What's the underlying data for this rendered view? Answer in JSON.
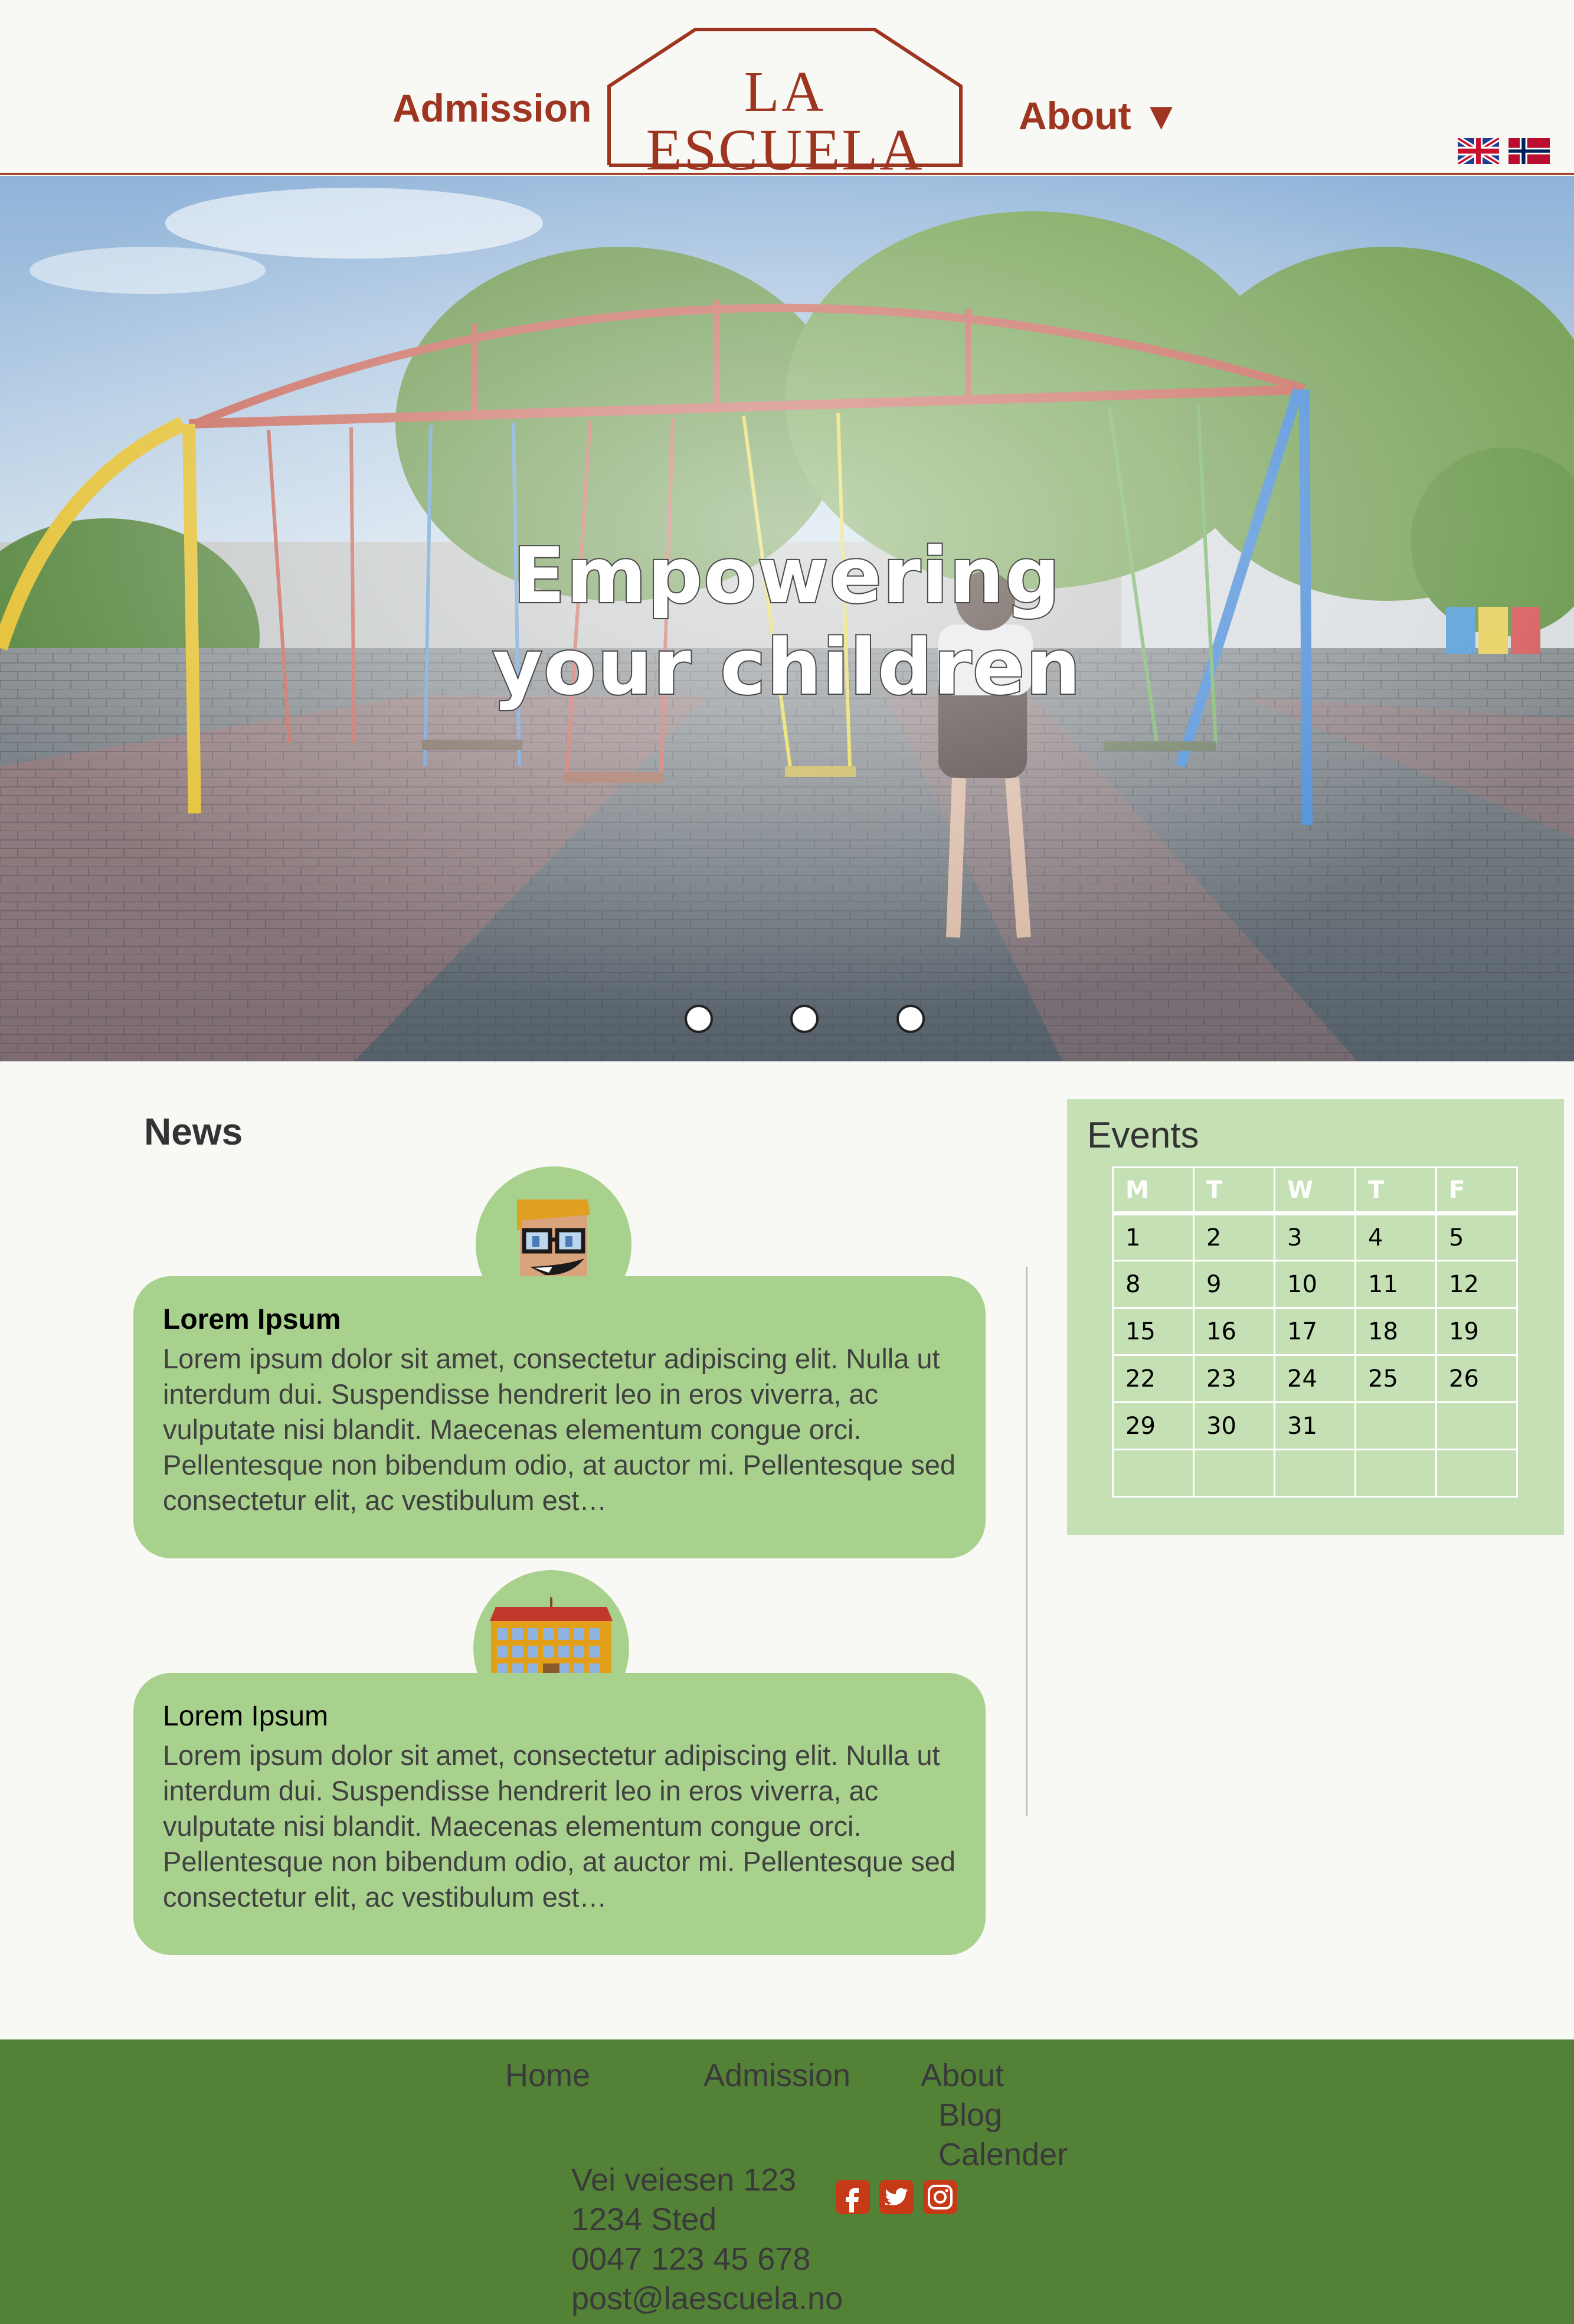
{
  "header": {
    "nav_admission": "Admission",
    "nav_about": "About ▼",
    "logo_line1": "LA",
    "logo_line2": "ESCUELA",
    "flags": [
      "uk-flag-icon",
      "norway-flag-icon"
    ]
  },
  "hero": {
    "headline_line1": "Empowering",
    "headline_line2": "your children",
    "slides": 3
  },
  "news": {
    "title": "News",
    "items": [
      {
        "icon": "teacher-avatar-icon",
        "heading": "Lorem Ipsum",
        "body": "Lorem ipsum dolor sit amet, consectetur adipiscing elit. Nulla ut interdum dui. Suspendisse hendrerit leo in eros viverra, ac vulputate nisi blandit. Maecenas elementum congue orci. Pellentesque non bibendum odio, at auctor mi. Pellentesque sed consectetur elit, ac vestibulum est…"
      },
      {
        "icon": "school-building-icon",
        "heading": "Lorem Ipsum",
        "body": "Lorem ipsum dolor sit amet, consectetur adipiscing elit. Nulla ut interdum dui. Suspendisse hendrerit leo in eros viverra, ac vulputate nisi blandit. Maecenas elementum congue orci. Pellentesque non bibendum odio, at auctor mi. Pellentesque sed consectetur elit, ac vestibulum est…"
      }
    ]
  },
  "events": {
    "title": "Events",
    "days": [
      "M",
      "T",
      "W",
      "T",
      "F"
    ],
    "weeks": [
      [
        "1",
        "2",
        "3",
        "4",
        "5"
      ],
      [
        "8",
        "9",
        "10",
        "11",
        "12"
      ],
      [
        "15",
        "16",
        "17",
        "18",
        "19"
      ],
      [
        "22",
        "23",
        "24",
        "25",
        "26"
      ],
      [
        "29",
        "30",
        "31",
        "",
        ""
      ],
      [
        "",
        "",
        "",
        "",
        ""
      ]
    ]
  },
  "footer": {
    "nav_home": "Home",
    "nav_admission": "Admission",
    "nav_about": "About",
    "nav_blog": "Blog",
    "nav_calender": "Calender",
    "address_line1": "Vei veiesen 123",
    "address_line2": "1234 Sted",
    "phone": "0047 123 45 678",
    "email": "post@laescuela.no",
    "social": [
      "facebook-icon",
      "twitter-icon",
      "instagram-icon"
    ]
  },
  "colors": {
    "brand": "#9e3520",
    "card_green": "#a9d18e",
    "events_green": "#c5e0b4",
    "footer_green": "#538135",
    "background": "#f8f8f5"
  }
}
